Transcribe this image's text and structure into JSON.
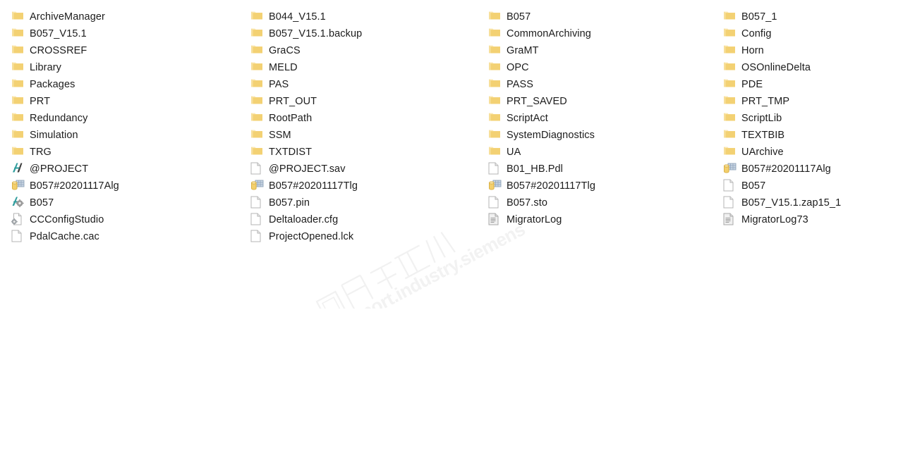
{
  "view": {
    "name": "windows-file-explorer-listing",
    "background_color": "#ffffff",
    "text_color": "#1c1c1c",
    "folder_color": "#f5d478",
    "layout": "multi-column-list"
  },
  "watermark": {
    "chinese_text": "西门子工业",
    "url_text": "support.industry.siemens",
    "color": "#f2f2f2"
  },
  "columns": [
    {
      "index": 0,
      "items": [
        {
          "name": "ArchiveManager",
          "icon": "folder-icon",
          "type": "folder"
        },
        {
          "name": "B057_V15.1",
          "icon": "folder-icon",
          "type": "folder"
        },
        {
          "name": "CROSSREF",
          "icon": "folder-icon",
          "type": "folder"
        },
        {
          "name": "Library",
          "icon": "folder-icon",
          "type": "folder"
        },
        {
          "name": "Packages",
          "icon": "folder-icon",
          "type": "folder"
        },
        {
          "name": "PRT",
          "icon": "folder-icon",
          "type": "folder"
        },
        {
          "name": "Redundancy",
          "icon": "folder-icon",
          "type": "folder"
        },
        {
          "name": "Simulation",
          "icon": "folder-icon",
          "type": "folder"
        },
        {
          "name": "TRG",
          "icon": "folder-icon",
          "type": "folder"
        },
        {
          "name": "@PROJECT",
          "icon": "wincc-project-icon",
          "type": "file"
        },
        {
          "name": "B057#20201117Alg",
          "icon": "archive-database-icon",
          "type": "file"
        },
        {
          "name": "B057",
          "icon": "wincc-gear-icon",
          "type": "file"
        },
        {
          "name": "CCConfigStudio",
          "icon": "document-gear-icon",
          "type": "file"
        },
        {
          "name": "PdalCache.cac",
          "icon": "blank-document-icon",
          "type": "file"
        }
      ]
    },
    {
      "index": 1,
      "items": [
        {
          "name": "B044_V15.1",
          "icon": "folder-icon",
          "type": "folder"
        },
        {
          "name": "B057_V15.1.backup",
          "icon": "folder-icon",
          "type": "folder"
        },
        {
          "name": "GraCS",
          "icon": "folder-icon",
          "type": "folder"
        },
        {
          "name": "MELD",
          "icon": "folder-icon",
          "type": "folder"
        },
        {
          "name": "PAS",
          "icon": "folder-icon",
          "type": "folder"
        },
        {
          "name": "PRT_OUT",
          "icon": "folder-icon",
          "type": "folder"
        },
        {
          "name": "RootPath",
          "icon": "folder-icon",
          "type": "folder"
        },
        {
          "name": "SSM",
          "icon": "folder-icon",
          "type": "folder"
        },
        {
          "name": "TXTDIST",
          "icon": "folder-icon",
          "type": "folder"
        },
        {
          "name": "@PROJECT.sav",
          "icon": "blank-document-icon",
          "type": "file"
        },
        {
          "name": "B057#20201117Tlg",
          "icon": "archive-database-icon",
          "type": "file"
        },
        {
          "name": "B057.pin",
          "icon": "blank-document-icon",
          "type": "file"
        },
        {
          "name": "Deltaloader.cfg",
          "icon": "blank-document-icon",
          "type": "file"
        },
        {
          "name": "ProjectOpened.lck",
          "icon": "blank-document-icon",
          "type": "file"
        }
      ]
    },
    {
      "index": 2,
      "items": [
        {
          "name": "B057",
          "icon": "folder-icon",
          "type": "folder"
        },
        {
          "name": "CommonArchiving",
          "icon": "folder-icon",
          "type": "folder"
        },
        {
          "name": "GraMT",
          "icon": "folder-icon",
          "type": "folder"
        },
        {
          "name": "OPC",
          "icon": "folder-icon",
          "type": "folder"
        },
        {
          "name": "PASS",
          "icon": "folder-icon",
          "type": "folder"
        },
        {
          "name": "PRT_SAVED",
          "icon": "folder-icon",
          "type": "folder"
        },
        {
          "name": "ScriptAct",
          "icon": "folder-icon",
          "type": "folder"
        },
        {
          "name": "SystemDiagnostics",
          "icon": "folder-icon",
          "type": "folder"
        },
        {
          "name": "UA",
          "icon": "folder-icon",
          "type": "folder"
        },
        {
          "name": "B01_HB.Pdl",
          "icon": "blank-document-icon",
          "type": "file"
        },
        {
          "name": "B057#20201117Tlg",
          "icon": "archive-database-icon",
          "type": "file"
        },
        {
          "name": "B057.sto",
          "icon": "blank-document-icon",
          "type": "file"
        },
        {
          "name": "MigratorLog",
          "icon": "log-document-icon",
          "type": "file"
        }
      ]
    },
    {
      "index": 3,
      "items": [
        {
          "name": "B057_1",
          "icon": "folder-icon",
          "type": "folder"
        },
        {
          "name": "Config",
          "icon": "folder-icon",
          "type": "folder"
        },
        {
          "name": "Horn",
          "icon": "folder-icon",
          "type": "folder"
        },
        {
          "name": "OSOnlineDelta",
          "icon": "folder-icon",
          "type": "folder"
        },
        {
          "name": "PDE",
          "icon": "folder-icon",
          "type": "folder"
        },
        {
          "name": "PRT_TMP",
          "icon": "folder-icon",
          "type": "folder"
        },
        {
          "name": "ScriptLib",
          "icon": "folder-icon",
          "type": "folder"
        },
        {
          "name": "TEXTBIB",
          "icon": "folder-icon",
          "type": "folder"
        },
        {
          "name": "UArchive",
          "icon": "folder-icon",
          "type": "folder"
        },
        {
          "name": "B057#20201117Alg",
          "icon": "archive-database-icon",
          "type": "file"
        },
        {
          "name": "B057",
          "icon": "blank-document-icon",
          "type": "file"
        },
        {
          "name": "B057_V15.1.zap15_1",
          "icon": "blank-document-icon",
          "type": "file"
        },
        {
          "name": "MigratorLog73",
          "icon": "log-document-icon",
          "type": "file"
        }
      ]
    }
  ]
}
